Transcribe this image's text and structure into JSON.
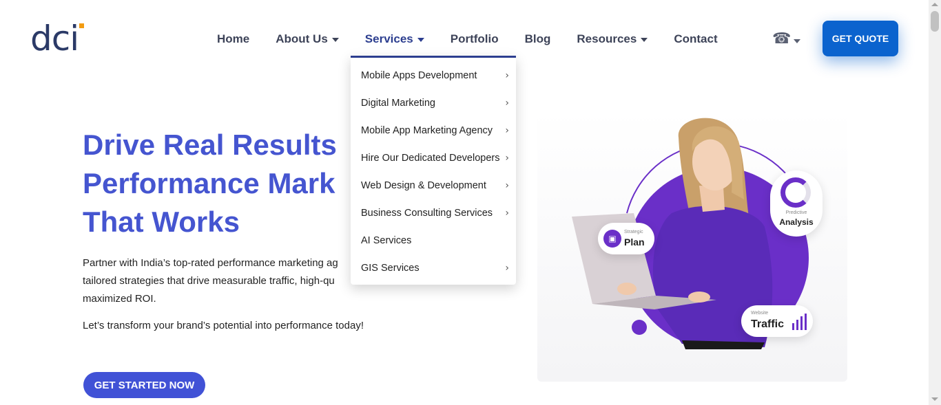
{
  "brand": {
    "logo_text": "dci",
    "accent_color": "#f39c12",
    "logo_color": "#2b3a67"
  },
  "nav": {
    "items": [
      {
        "label": "Home",
        "has_caret": false
      },
      {
        "label": "About Us",
        "has_caret": true
      },
      {
        "label": "Services",
        "has_caret": true,
        "active": true
      },
      {
        "label": "Portfolio",
        "has_caret": false
      },
      {
        "label": "Blog",
        "has_caret": false
      },
      {
        "label": "Resources",
        "has_caret": true
      },
      {
        "label": "Contact",
        "has_caret": false
      }
    ],
    "phone_icon": "telephone-icon",
    "quote_button": "GET QUOTE"
  },
  "services_menu": {
    "items": [
      {
        "label": "Mobile Apps Development",
        "submenu": true
      },
      {
        "label": "Digital Marketing",
        "submenu": true
      },
      {
        "label": "Mobile App Marketing Agency",
        "submenu": true
      },
      {
        "label": "Hire Our Dedicated Developers",
        "submenu": true
      },
      {
        "label": "Web Design & Development",
        "submenu": true
      },
      {
        "label": "Business Consulting Services",
        "submenu": true
      },
      {
        "label": "AI Services",
        "submenu": false
      },
      {
        "label": "GIS Services",
        "submenu": true
      }
    ],
    "chevron": "›"
  },
  "hero": {
    "title_lines": [
      "Drive Real Results",
      "Performance Mark",
      "That Works"
    ],
    "description_lines": [
      "Partner with India’s top-rated performance marketing ag",
      "tailored strategies that drive measurable traffic, high-qu",
      "maximized ROI."
    ],
    "tagline": "Let’s transform your brand’s potential into performance today!",
    "cta": "GET STARTED NOW",
    "title_color": "#4555d0",
    "cta_color": "#4152d6"
  },
  "illustration": {
    "badges": [
      {
        "small": "Strategic",
        "big": "Plan"
      },
      {
        "small": "Predictive",
        "big": "Analysis"
      },
      {
        "small": "Website",
        "big": "Traffic"
      }
    ],
    "accent_purple": "#6a2fc8"
  }
}
